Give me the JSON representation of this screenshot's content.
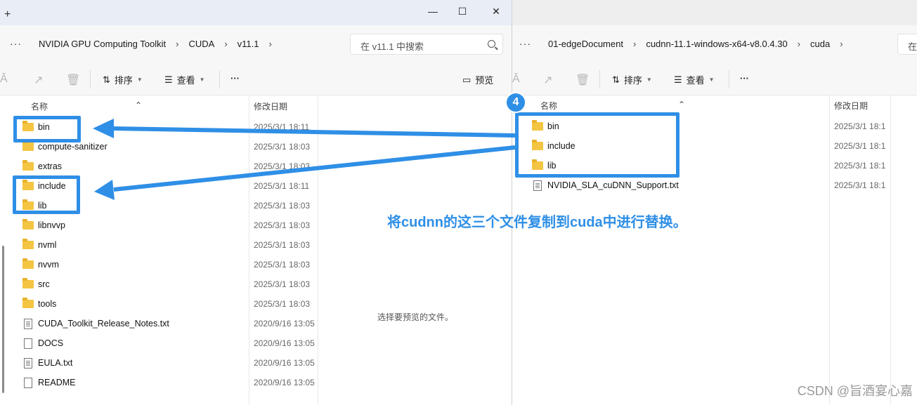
{
  "left_window": {
    "breadcrumbs": [
      "NVIDIA GPU Computing Toolkit",
      "CUDA",
      "v11.1"
    ],
    "search_placeholder": "在 v11.1 中搜索",
    "toolbar": {
      "sort": "排序",
      "view": "查看",
      "preview": "预览"
    },
    "columns": {
      "name": "名称",
      "modified": "修改日期"
    },
    "files": [
      {
        "name": "bin",
        "date": "2025/3/1 18:11",
        "type": "folder"
      },
      {
        "name": "compute-sanitizer",
        "date": "2025/3/1 18:03",
        "type": "folder"
      },
      {
        "name": "extras",
        "date": "2025/3/1 18:03",
        "type": "folder"
      },
      {
        "name": "include",
        "date": "2025/3/1 18:11",
        "type": "folder"
      },
      {
        "name": "lib",
        "date": "2025/3/1 18:03",
        "type": "folder"
      },
      {
        "name": "libnvvp",
        "date": "2025/3/1 18:03",
        "type": "folder"
      },
      {
        "name": "nvml",
        "date": "2025/3/1 18:03",
        "type": "folder"
      },
      {
        "name": "nvvm",
        "date": "2025/3/1 18:03",
        "type": "folder"
      },
      {
        "name": "src",
        "date": "2025/3/1 18:03",
        "type": "folder"
      },
      {
        "name": "tools",
        "date": "2025/3/1 18:03",
        "type": "folder"
      },
      {
        "name": "CUDA_Toolkit_Release_Notes.txt",
        "date": "2020/9/16 13:05",
        "type": "txt"
      },
      {
        "name": "DOCS",
        "date": "2020/9/16 13:05",
        "type": "file"
      },
      {
        "name": "EULA.txt",
        "date": "2020/9/16 13:05",
        "type": "txt"
      },
      {
        "name": "README",
        "date": "2020/9/16 13:05",
        "type": "file"
      }
    ],
    "preview_message": "选择要预览的文件。"
  },
  "right_window": {
    "breadcrumbs": [
      "01-edgeDocument",
      "cudnn-11.1-windows-x64-v8.0.4.30",
      "cuda"
    ],
    "toolbar": {
      "sort": "排序",
      "view": "查看"
    },
    "columns": {
      "name": "名称",
      "modified": "修改日期"
    },
    "files": [
      {
        "name": "bin",
        "date": "2025/3/1 18:1",
        "type": "folder"
      },
      {
        "name": "include",
        "date": "2025/3/1 18:1",
        "type": "folder"
      },
      {
        "name": "lib",
        "date": "2025/3/1 18:1",
        "type": "folder"
      },
      {
        "name": "NVIDIA_SLA_cuDNN_Support.txt",
        "date": "2025/3/1 18:1",
        "type": "txt"
      }
    ]
  },
  "annotation": {
    "step": "4",
    "text": "将cudnn的这三个文件复制到cuda中进行替换。",
    "color": "#2f8fe6"
  },
  "watermark": "CSDN @旨酒宴心嘉"
}
